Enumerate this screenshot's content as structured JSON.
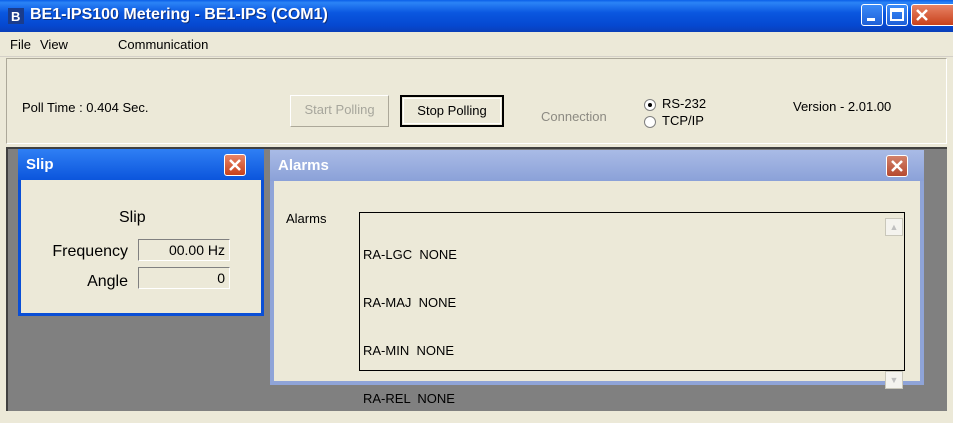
{
  "window": {
    "title": "BE1-IPS100 Metering - BE1-IPS (COM1)"
  },
  "menu": [
    {
      "label": "File"
    },
    {
      "label": "View"
    },
    {
      "label": "Communication"
    }
  ],
  "toolbar": {
    "poll_time": "Poll Time : 0.404 Sec.",
    "start_label": "Start Polling",
    "stop_label": "Stop Polling",
    "connection_label": "Connection",
    "rs232_label": "RS-232",
    "tcpip_label": "TCP/IP",
    "selected_connection": "RS-232",
    "version": "Version - 2.01.00"
  },
  "slip_window": {
    "title": "Slip",
    "heading": "Slip",
    "frequency_label": "Frequency",
    "frequency_value": "00.00 Hz",
    "angle_label": "Angle",
    "angle_value": "0"
  },
  "alarms_window": {
    "title": "Alarms",
    "label": "Alarms",
    "lines": [
      "RA-LGC  NONE",
      "RA-MAJ  NONE",
      "RA-MIN  NONE",
      "RA-REL  NONE"
    ]
  },
  "colors": {
    "titlebar_active": "#0a57e0",
    "child_inactive": "#8ba1d8",
    "background": "#ece9d8",
    "mdi_background": "#808080"
  }
}
